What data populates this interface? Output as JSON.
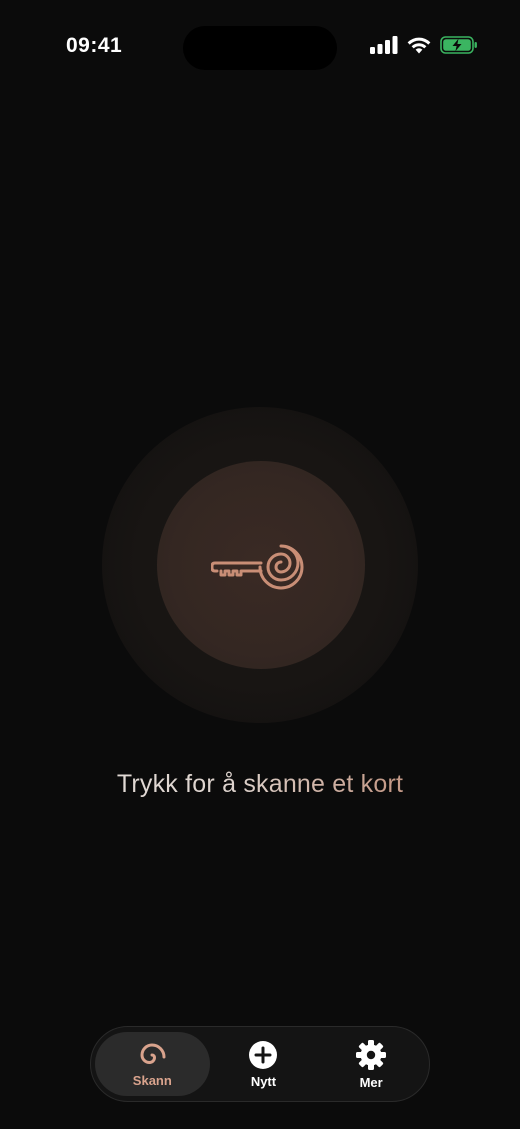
{
  "status_bar": {
    "time": "09:41"
  },
  "main": {
    "scan_icon": "key-spiral-icon",
    "prompt": "Trykk for å skanne et kort",
    "accent_color": "#c99b88"
  },
  "tab_bar": {
    "tabs": [
      {
        "label": "Skann",
        "icon": "spiral-icon",
        "active": true
      },
      {
        "label": "Nytt",
        "icon": "plus-circle-icon",
        "active": false
      },
      {
        "label": "Mer",
        "icon": "gear-icon",
        "active": false
      }
    ]
  }
}
